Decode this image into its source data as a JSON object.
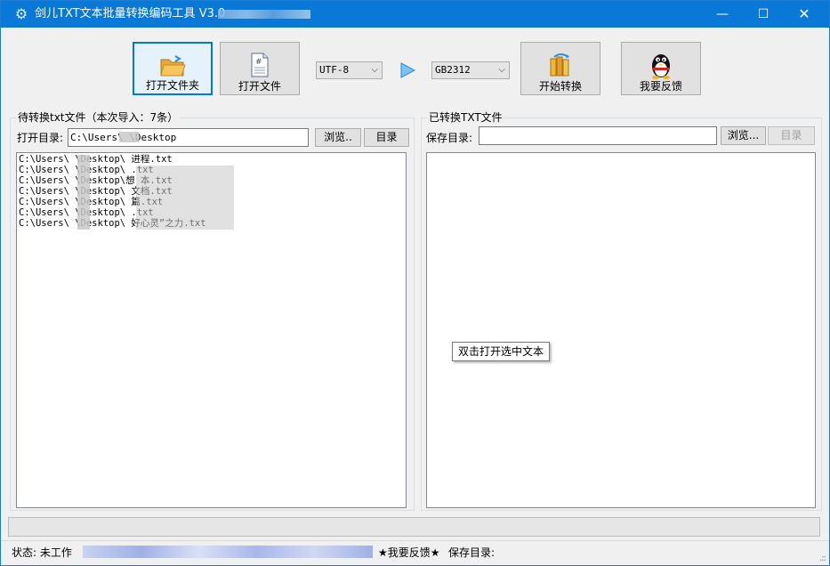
{
  "window": {
    "title": "剑儿TXT文本批量转换编码工具 V3.0",
    "minimize": "—",
    "maximize": "☐",
    "close": "✕"
  },
  "toolbar": {
    "open_folder_label": "打开文件夹",
    "open_file_label": "打开文件",
    "source_encoding": "UTF-8",
    "target_encoding": "GB2312",
    "start_label": "开始转换",
    "feedback_label": "我要反馈"
  },
  "left_panel": {
    "title": "待转换txt文件（本次导入：7条）",
    "dir_label": "打开目录:",
    "dir_value": "C:\\Users\\     \\Desktop",
    "browse_label": "浏览..",
    "dir_button_label": "目录",
    "files": [
      "C:\\Users\\   \\Desktop\\   进程.txt",
      "C:\\Users\\   \\Desktop\\     .txt",
      "C:\\Users\\   \\Desktop\\想       本.txt",
      "C:\\Users\\   \\Desktop\\       文档.txt",
      "C:\\Users\\   \\Desktop\\         篇.txt",
      "C:\\Users\\   \\Desktop\\        .txt",
      "C:\\Users\\   \\Desktop\\          好心灵”之力.txt"
    ]
  },
  "right_panel": {
    "title": "已转换TXT文件",
    "save_label": "保存目录:",
    "save_value": "",
    "browse_label": "浏览...",
    "dir_button_label": "目录",
    "tooltip": "双击打开选中文本"
  },
  "status": {
    "state_label": "状态: 未工作",
    "link_text": "",
    "feedback": "★我要反馈★",
    "save_dir_label": "保存目录:"
  },
  "icons": {
    "app": "gear-icon",
    "open_folder": "folder-open-icon",
    "open_file": "document-icon",
    "arrow": "play-arrow-icon",
    "start": "convert-books-icon",
    "feedback": "qq-penguin-icon"
  },
  "colors": {
    "titlebar": "#0a78d7",
    "accent": "#0078d7",
    "link": "#0033cc"
  }
}
